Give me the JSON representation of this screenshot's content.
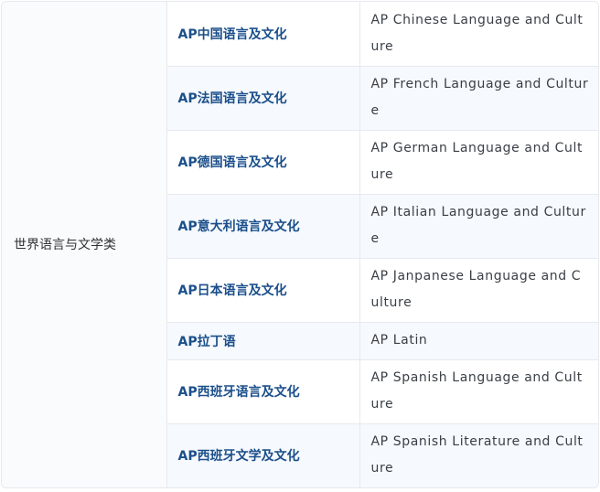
{
  "category": "世界语言与文学类",
  "courses": [
    {
      "cn": "AP中国语言及文化",
      "en": "AP Chinese  Language and Culture"
    },
    {
      "cn": "AP法国语言及文化",
      "en": "AP French  Language and Culture"
    },
    {
      "cn": "AP德国语言及文化",
      "en": "AP German  Language and Culture"
    },
    {
      "cn": "AP意大利语言及文化",
      "en": "AP Italian  Language and Culture"
    },
    {
      "cn": "AP日本语言及文化",
      "en": "AP Janpanese  Language and Culture"
    },
    {
      "cn": "AP拉丁语",
      "en": "AP Latin"
    },
    {
      "cn": "AP西班牙语言及文化",
      "en": "AP Spanish  Language and Culture"
    },
    {
      "cn": "AP西班牙文学及文化",
      "en": "AP Spanish  Literature and Culture"
    }
  ]
}
